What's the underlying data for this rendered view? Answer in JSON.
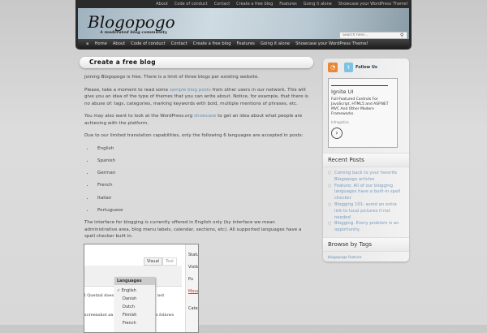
{
  "top_nav": [
    "About",
    "Code of conduct",
    "Contact",
    "Create a free blog",
    "Features",
    "Going it alone",
    "Showcase your WordPress Theme!"
  ],
  "site": {
    "title": "Blogopogo",
    "tagline": "A moderated blog community"
  },
  "search": {
    "placeholder": "Search here..."
  },
  "main_nav": [
    "Home",
    "About",
    "Code of conduct",
    "Contact",
    "Create a free blog",
    "Features",
    "Going it alone",
    "Showcase your WordPress Theme!"
  ],
  "page": {
    "title": "Create a free blog",
    "p1": "Joining Blogopogo is free.  There is a limit of three blogs per existing website.",
    "p2a": "Please, take a moment to read some ",
    "p2link": "sample blog posts",
    "p2b": " from other users in our network.  This will give you an idea of the type of themes that you can write about.  Notice, for example, that there is no abuse of: tags, categories, marking keywords with bold, multiple mentions of phrases, etc.",
    "p3a": "You may also want to look at the WordPress.org ",
    "p3link": "showcase",
    "p3b": " to get an idea about what people are achieving with the platform.",
    "p4": "Due to our limited translation capabilities, only the following 6 languages are accepted in posts:",
    "languages": [
      "English",
      "Spanish",
      "German",
      "French",
      "Italian",
      "Portuguese"
    ],
    "p5": "The interface for blogging is currently offered in English only (by interface we mean administrative area, blog menu labels, calendar, sections, etc). All supported languages have a spell checker built in."
  },
  "screenshot": {
    "tab_visual": "Visual",
    "tab_text": "Text",
    "menu_title": "Languages",
    "menu_items": [
      "English",
      "Danish",
      "Dutch",
      "Finnish",
      "French"
    ],
    "text1": "l Quetzal does",
    "text1b": "not",
    "text2": "screenshot an",
    "text2b": "s follows",
    "side": [
      "Statu",
      "Visibi",
      "Pu",
      "Move",
      "Categ"
    ]
  },
  "sidebar": {
    "follow": "Follow Us",
    "ad": {
      "title": "Ignite UI",
      "text": "Full-Featured Controls For JavaScript, HTML5 and ASP.NET MVC And Other Modern Frameworks.",
      "source": "Infragistics"
    },
    "recent_title": "Recent Posts",
    "recent": [
      "Coming back to your favorite Blogopogo articles",
      "Feature: All of our blogging languages have a built-in spell checker",
      "Blogging 101: avoid an extra link to local pictures if not needed",
      "Blogging. Every problem is an opportunity."
    ],
    "tags_title": "Browse by Tags",
    "tags": "blogopogo feature"
  }
}
